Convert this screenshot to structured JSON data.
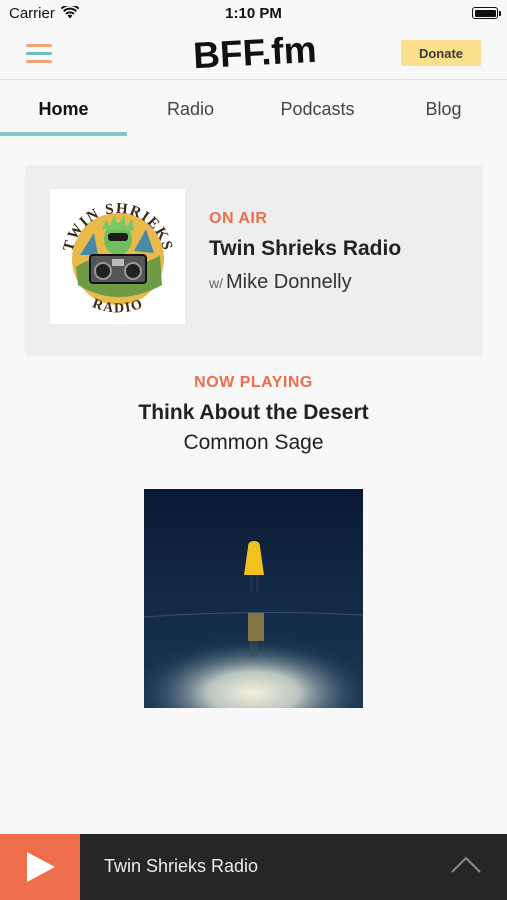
{
  "status_bar": {
    "carrier": "Carrier",
    "time": "1:10 PM",
    "wifi_icon": "wifi-icon",
    "battery_icon": "battery-icon"
  },
  "header": {
    "menu_icon": "hamburger-menu-icon",
    "logo_text": "BFF.fm",
    "donate_label": "Donate",
    "colors": {
      "donate_bg": "#fbdf8a",
      "menu_orange": "#f2a57b",
      "menu_teal": "#6bbfc1"
    }
  },
  "tabs": [
    {
      "label": "Home",
      "active": true
    },
    {
      "label": "Radio",
      "active": false
    },
    {
      "label": "Podcasts",
      "active": false
    },
    {
      "label": "Blog",
      "active": false
    }
  ],
  "on_air": {
    "label": "ON AIR",
    "show_title": "Twin Shrieks Radio",
    "host_prefix": "w/",
    "host": "Mike Donnelly",
    "artwork": {
      "top_text": "TWIN SHRIEKS",
      "bottom_text": "RADIO"
    }
  },
  "now_playing": {
    "label": "NOW PLAYING",
    "track": "Think About the Desert",
    "artist": "Common Sage"
  },
  "player": {
    "play_icon": "play-icon",
    "title": "Twin Shrieks Radio",
    "expand_icon": "chevron-up-icon",
    "colors": {
      "accent": "#ee6e4c",
      "bar_bg": "#262626"
    }
  }
}
